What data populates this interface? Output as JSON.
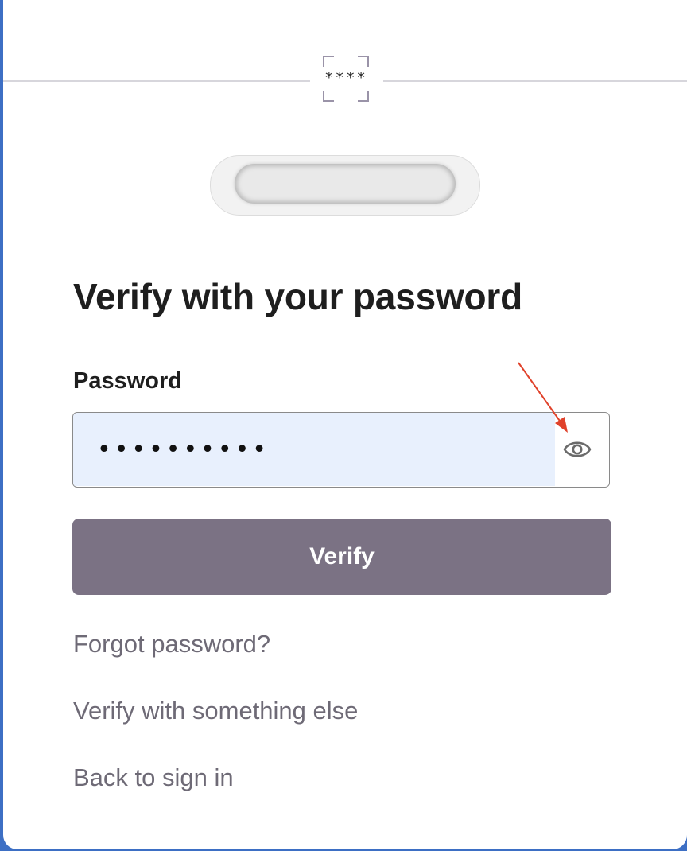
{
  "logo": {
    "mask_text": "****"
  },
  "heading": "Verify with your password",
  "password": {
    "label": "Password",
    "value": "••••••••••"
  },
  "buttons": {
    "verify": "Verify"
  },
  "links": {
    "forgot": "Forgot password?",
    "other": "Verify with something else",
    "back": "Back to sign in"
  },
  "icons": {
    "reveal_password": "eye-icon",
    "annotation": "red-arrow-annotation"
  },
  "colors": {
    "primary_button": "#7b7284",
    "input_autofill_bg": "#e8f0fd",
    "link_text": "#6e6a76",
    "annotation_arrow": "#e0422b"
  }
}
